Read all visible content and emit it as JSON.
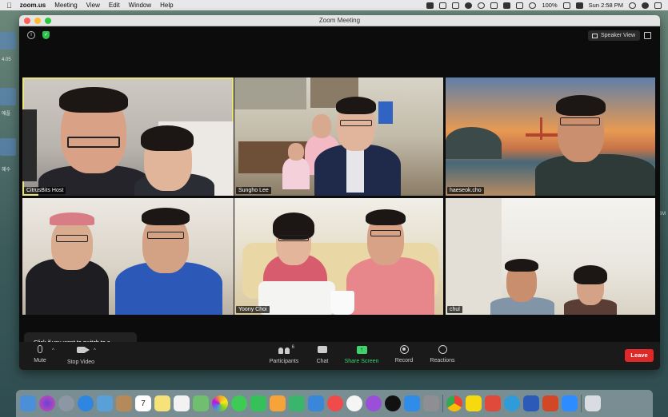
{
  "menubar": {
    "app_name": "zoom.us",
    "menus": [
      "Meeting",
      "View",
      "Edit",
      "Window",
      "Help"
    ],
    "battery": "100%",
    "clock": "Sun 2:58 PM"
  },
  "desktop": {
    "labels": [
      "4.05",
      "애플",
      "혜수",
      "SM"
    ]
  },
  "window": {
    "title": "Zoom Meeting",
    "speaker_view_label": "Speaker View"
  },
  "participants": [
    {
      "name": "CitrusBits Host"
    },
    {
      "name": "Sungho Lee"
    },
    {
      "name": "haeseok.cho"
    },
    {
      "name": ""
    },
    {
      "name": "Yoony Choi"
    },
    {
      "name": "chul"
    }
  ],
  "tooltip": {
    "text": "Click if you want to switch to a different microphone or speaker"
  },
  "toolbar": {
    "mute": "Mute",
    "stop_video": "Stop Video",
    "participants": "Participants",
    "participants_count": "6",
    "chat": "Chat",
    "share_screen": "Share Screen",
    "record": "Record",
    "reactions": "Reactions",
    "leave": "Leave"
  },
  "dock": {
    "calendar_day": "7",
    "apps": [
      "finder-icon",
      "siri-icon",
      "launchpad-icon",
      "safari-icon",
      "preview-icon",
      "contacts-icon",
      "calendar-icon",
      "notes-icon",
      "reminders-icon",
      "maps-icon",
      "photos-icon",
      "messages-icon",
      "facetime-icon",
      "pages-icon",
      "numbers-icon",
      "keynote-icon",
      "news-icon",
      "music-icon",
      "podcasts-icon",
      "tv-icon",
      "appstore-icon",
      "settings-icon",
      "chrome-icon",
      "kakaotalk-icon",
      "pdf-icon",
      "edge-icon",
      "word-icon",
      "powerpoint-icon",
      "zoom-icon",
      "trash-icon"
    ]
  },
  "colors": {
    "active_border": "#e9e57a",
    "leave": "#e02828",
    "share": "#3fd36b"
  }
}
